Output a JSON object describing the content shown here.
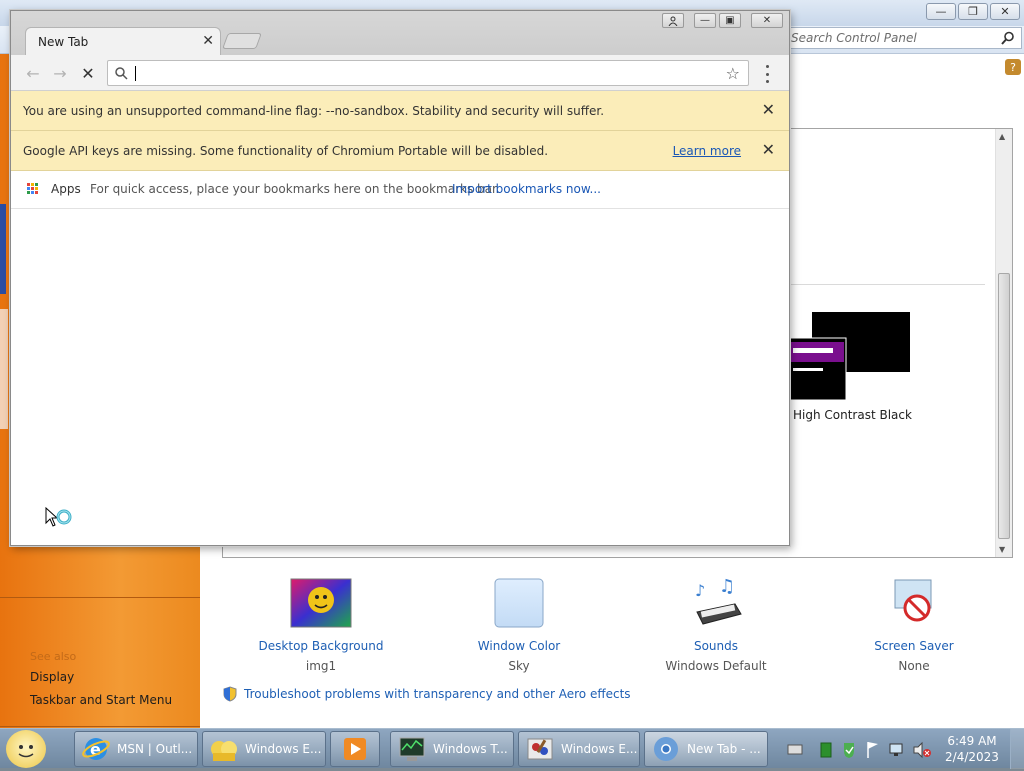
{
  "control_panel": {
    "search_placeholder": "Search Control Panel",
    "theme_label": "High Contrast Black",
    "sidebar": {
      "see_also": "See also",
      "links": [
        "Display",
        "Taskbar and Start Menu"
      ]
    },
    "items": [
      {
        "title": "Desktop Background",
        "sub": "img1"
      },
      {
        "title": "Window Color",
        "sub": "Sky"
      },
      {
        "title": "Sounds",
        "sub": "Windows Default"
      },
      {
        "title": "Screen Saver",
        "sub": "None"
      }
    ],
    "troubleshoot": "Troubleshoot problems with transparency and other Aero effects"
  },
  "chromium": {
    "tab_title": "New Tab",
    "omnibox_value": "",
    "infobars": [
      {
        "text": "You are using an unsupported command-line flag: --no-sandbox. Stability and security will suffer."
      },
      {
        "text": "Google API keys are missing. Some functionality of Chromium Portable will be disabled.",
        "link": "Learn more"
      }
    ],
    "bookmarks_bar": {
      "apps_label": "Apps",
      "hint": "For quick access, place your bookmarks here on the bookmarks bar.",
      "import_link": "Import bookmarks now..."
    }
  },
  "taskbar": {
    "buttons": [
      {
        "label": "MSN | Outl..."
      },
      {
        "label": "Windows E..."
      },
      {
        "label": ""
      },
      {
        "label": "Windows T..."
      },
      {
        "label": "Windows E..."
      },
      {
        "label": "New Tab - ..."
      }
    ],
    "clock_time": "6:49 AM",
    "clock_date": "2/4/2023"
  }
}
